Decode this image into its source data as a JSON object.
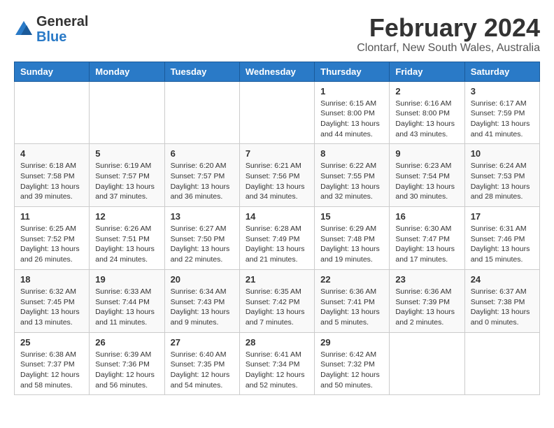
{
  "header": {
    "logo_general": "General",
    "logo_blue": "Blue",
    "main_title": "February 2024",
    "subtitle": "Clontarf, New South Wales, Australia"
  },
  "calendar": {
    "days_of_week": [
      "Sunday",
      "Monday",
      "Tuesday",
      "Wednesday",
      "Thursday",
      "Friday",
      "Saturday"
    ],
    "weeks": [
      [
        {
          "day": "",
          "info": ""
        },
        {
          "day": "",
          "info": ""
        },
        {
          "day": "",
          "info": ""
        },
        {
          "day": "",
          "info": ""
        },
        {
          "day": "1",
          "info": "Sunrise: 6:15 AM\nSunset: 8:00 PM\nDaylight: 13 hours\nand 44 minutes."
        },
        {
          "day": "2",
          "info": "Sunrise: 6:16 AM\nSunset: 8:00 PM\nDaylight: 13 hours\nand 43 minutes."
        },
        {
          "day": "3",
          "info": "Sunrise: 6:17 AM\nSunset: 7:59 PM\nDaylight: 13 hours\nand 41 minutes."
        }
      ],
      [
        {
          "day": "4",
          "info": "Sunrise: 6:18 AM\nSunset: 7:58 PM\nDaylight: 13 hours\nand 39 minutes."
        },
        {
          "day": "5",
          "info": "Sunrise: 6:19 AM\nSunset: 7:57 PM\nDaylight: 13 hours\nand 37 minutes."
        },
        {
          "day": "6",
          "info": "Sunrise: 6:20 AM\nSunset: 7:57 PM\nDaylight: 13 hours\nand 36 minutes."
        },
        {
          "day": "7",
          "info": "Sunrise: 6:21 AM\nSunset: 7:56 PM\nDaylight: 13 hours\nand 34 minutes."
        },
        {
          "day": "8",
          "info": "Sunrise: 6:22 AM\nSunset: 7:55 PM\nDaylight: 13 hours\nand 32 minutes."
        },
        {
          "day": "9",
          "info": "Sunrise: 6:23 AM\nSunset: 7:54 PM\nDaylight: 13 hours\nand 30 minutes."
        },
        {
          "day": "10",
          "info": "Sunrise: 6:24 AM\nSunset: 7:53 PM\nDaylight: 13 hours\nand 28 minutes."
        }
      ],
      [
        {
          "day": "11",
          "info": "Sunrise: 6:25 AM\nSunset: 7:52 PM\nDaylight: 13 hours\nand 26 minutes."
        },
        {
          "day": "12",
          "info": "Sunrise: 6:26 AM\nSunset: 7:51 PM\nDaylight: 13 hours\nand 24 minutes."
        },
        {
          "day": "13",
          "info": "Sunrise: 6:27 AM\nSunset: 7:50 PM\nDaylight: 13 hours\nand 22 minutes."
        },
        {
          "day": "14",
          "info": "Sunrise: 6:28 AM\nSunset: 7:49 PM\nDaylight: 13 hours\nand 21 minutes."
        },
        {
          "day": "15",
          "info": "Sunrise: 6:29 AM\nSunset: 7:48 PM\nDaylight: 13 hours\nand 19 minutes."
        },
        {
          "day": "16",
          "info": "Sunrise: 6:30 AM\nSunset: 7:47 PM\nDaylight: 13 hours\nand 17 minutes."
        },
        {
          "day": "17",
          "info": "Sunrise: 6:31 AM\nSunset: 7:46 PM\nDaylight: 13 hours\nand 15 minutes."
        }
      ],
      [
        {
          "day": "18",
          "info": "Sunrise: 6:32 AM\nSunset: 7:45 PM\nDaylight: 13 hours\nand 13 minutes."
        },
        {
          "day": "19",
          "info": "Sunrise: 6:33 AM\nSunset: 7:44 PM\nDaylight: 13 hours\nand 11 minutes."
        },
        {
          "day": "20",
          "info": "Sunrise: 6:34 AM\nSunset: 7:43 PM\nDaylight: 13 hours\nand 9 minutes."
        },
        {
          "day": "21",
          "info": "Sunrise: 6:35 AM\nSunset: 7:42 PM\nDaylight: 13 hours\nand 7 minutes."
        },
        {
          "day": "22",
          "info": "Sunrise: 6:36 AM\nSunset: 7:41 PM\nDaylight: 13 hours\nand 5 minutes."
        },
        {
          "day": "23",
          "info": "Sunrise: 6:36 AM\nSunset: 7:39 PM\nDaylight: 13 hours\nand 2 minutes."
        },
        {
          "day": "24",
          "info": "Sunrise: 6:37 AM\nSunset: 7:38 PM\nDaylight: 13 hours\nand 0 minutes."
        }
      ],
      [
        {
          "day": "25",
          "info": "Sunrise: 6:38 AM\nSunset: 7:37 PM\nDaylight: 12 hours\nand 58 minutes."
        },
        {
          "day": "26",
          "info": "Sunrise: 6:39 AM\nSunset: 7:36 PM\nDaylight: 12 hours\nand 56 minutes."
        },
        {
          "day": "27",
          "info": "Sunrise: 6:40 AM\nSunset: 7:35 PM\nDaylight: 12 hours\nand 54 minutes."
        },
        {
          "day": "28",
          "info": "Sunrise: 6:41 AM\nSunset: 7:34 PM\nDaylight: 12 hours\nand 52 minutes."
        },
        {
          "day": "29",
          "info": "Sunrise: 6:42 AM\nSunset: 7:32 PM\nDaylight: 12 hours\nand 50 minutes."
        },
        {
          "day": "",
          "info": ""
        },
        {
          "day": "",
          "info": ""
        }
      ]
    ]
  }
}
